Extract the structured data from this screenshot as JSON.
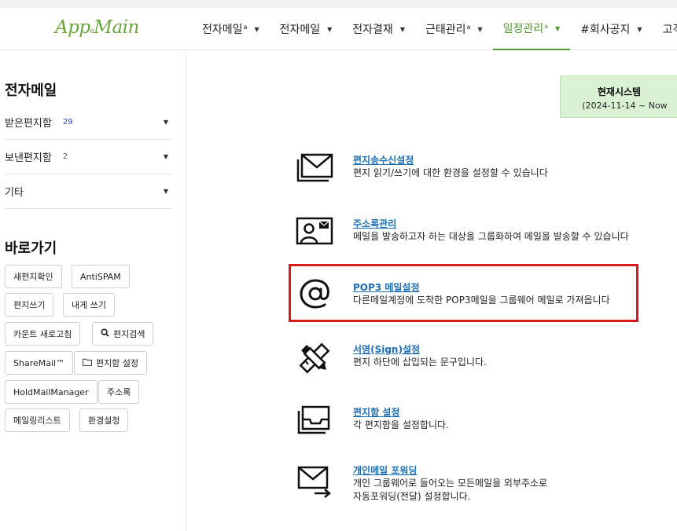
{
  "logo": {
    "text": "App",
    "sub": "e",
    "text2": "Main"
  },
  "nav": [
    {
      "label": "전자메일",
      "sup": "a",
      "active": false
    },
    {
      "label": "전자메일",
      "sup": "",
      "active": false
    },
    {
      "label": "전자결재",
      "sup": "",
      "active": false
    },
    {
      "label": "근태관리",
      "sup": "a",
      "active": false
    },
    {
      "label": "일정관리",
      "sup": "a",
      "active": true
    },
    {
      "label": "#회사공지",
      "sup": "",
      "active": false
    },
    {
      "label": "고객지",
      "sup": "",
      "active": false
    }
  ],
  "sidebar": {
    "title": "전자메일",
    "folders": [
      {
        "label": "받은편지함",
        "count": "29"
      },
      {
        "label": "보낸편지함",
        "count": "2"
      },
      {
        "label": "기타",
        "count": ""
      }
    ],
    "shortcuts_title": "바로가기",
    "shortcuts": [
      {
        "label": "새편지확인",
        "icon": ""
      },
      {
        "label": "AntiSPAM",
        "icon": ""
      },
      {
        "label": "편지쓰기",
        "icon": ""
      },
      {
        "label": "내게 쓰기",
        "icon": ""
      },
      {
        "label": "카운트 새로고침",
        "icon": ""
      },
      {
        "label": "편지검색",
        "icon": "search-icon"
      },
      {
        "label": "ShareMail™",
        "icon": ""
      },
      {
        "label": "편지함 설정",
        "icon": "folder-icon"
      },
      {
        "label": "HoldMailManager",
        "icon": ""
      },
      {
        "label": "주소록",
        "icon": ""
      },
      {
        "label": "메일링리스트",
        "icon": ""
      },
      {
        "label": "환경설정",
        "icon": ""
      }
    ]
  },
  "system_box": {
    "title": "현재시스템",
    "period": "(2024-11-14 ~ Now"
  },
  "settings": [
    {
      "title": "편지송수신설정",
      "desc": [
        "편지 읽기/쓰기에 대한 환경을 설정할 수 있습니다"
      ],
      "icon": "envelope-icon"
    },
    {
      "title": "주소록관리",
      "desc": [
        "메일을 발송하고자 하는 대상을 그룹화하여 메일을 발송할 수 있습니다"
      ],
      "icon": "contact-card-icon"
    },
    {
      "title": "POP3 메일설정",
      "desc": [
        "다른메일계정에 도착한 POP3메일을 그룹웨어 메일로 가져옵니다"
      ],
      "icon": "at-sign-icon"
    },
    {
      "title": "서명(Sign)설정",
      "desc": [
        "편지 하단에 삽입되는 문구입니다."
      ],
      "icon": "pencil-ruler-icon"
    },
    {
      "title": "편지함 설정",
      "desc": [
        "각 편지함을 설정합니다."
      ],
      "icon": "inbox-tray-icon"
    },
    {
      "title": "개인메일 포워딩",
      "desc": [
        "개인 그룹웨어로 들어오는 모든메일을 외부주소로",
        "자동포워딩(전달) 설정합니다."
      ],
      "icon": "forward-mail-icon"
    }
  ]
}
